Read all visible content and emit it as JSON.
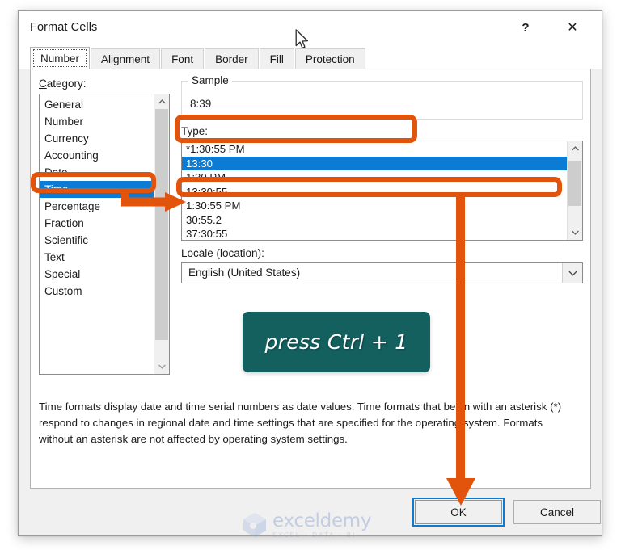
{
  "dialog": {
    "title": "Format Cells",
    "help_label": "?",
    "close_label": "✕"
  },
  "tabs": [
    {
      "label": "Number",
      "active": true
    },
    {
      "label": "Alignment",
      "active": false
    },
    {
      "label": "Font",
      "active": false
    },
    {
      "label": "Border",
      "active": false
    },
    {
      "label": "Fill",
      "active": false
    },
    {
      "label": "Protection",
      "active": false
    }
  ],
  "category": {
    "label": "Category:",
    "items": [
      "General",
      "Number",
      "Currency",
      "Accounting",
      "Date",
      "Time",
      "Percentage",
      "Fraction",
      "Scientific",
      "Text",
      "Special",
      "Custom"
    ],
    "selected": "Time",
    "scroll_up_icon": "chevron-up-icon",
    "scroll_down_icon": "chevron-down-icon"
  },
  "sample": {
    "legend": "Sample",
    "value": "8:39"
  },
  "type": {
    "label": "Type:",
    "items": [
      "*1:30:55 PM",
      "13:30",
      "1:30 PM",
      "13:30:55",
      "1:30:55 PM",
      "30:55.2",
      "37:30:55"
    ],
    "selected": "13:30",
    "scroll_up_icon": "chevron-up-icon",
    "scroll_down_icon": "chevron-down-icon"
  },
  "locale": {
    "label": "Locale (location):",
    "value": "English (United States)",
    "dropdown_icon": "chevron-down-icon"
  },
  "callout": {
    "text": "press Ctrl + 1",
    "background_color": "#14605f",
    "text_color": "#ffffff"
  },
  "description": "Time formats display date and time serial numbers as date values.  Time formats that begin with an asterisk (*) respond to changes in regional date and time settings that are specified for the operating system. Formats without an asterisk are not affected by operating system settings.",
  "footer": {
    "ok_label": "OK",
    "cancel_label": "Cancel"
  },
  "annotations": {
    "accent_color": "#e2540b",
    "selection_color": "#0b7bd4",
    "focus_color": "#0b7bd4"
  },
  "watermark": {
    "name": "exceldemy",
    "tagline": "EXCEL - DATA - BI"
  }
}
